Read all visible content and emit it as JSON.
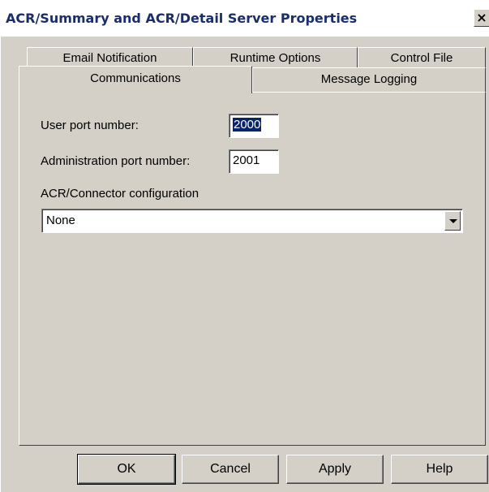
{
  "window": {
    "title": "ACR/Summary and ACR/Detail Server Properties",
    "close_glyph": "×"
  },
  "tabs": {
    "back_row": [
      "Email Notification",
      "Runtime Options",
      "Control File"
    ],
    "front_row": [
      "Communications",
      "Message Logging"
    ],
    "selected": "Communications"
  },
  "form": {
    "user_port_label": "User port number:",
    "user_port_value": "2000",
    "admin_port_label": "Administration port number:",
    "admin_port_value": "2001",
    "connector_label": "ACR/Connector configuration",
    "connector_value": "None"
  },
  "buttons": {
    "ok": "OK",
    "cancel": "Cancel",
    "apply": "Apply",
    "help": "Help"
  },
  "icons": {
    "close": "close-icon",
    "dropdown": "chevron-down-icon"
  }
}
